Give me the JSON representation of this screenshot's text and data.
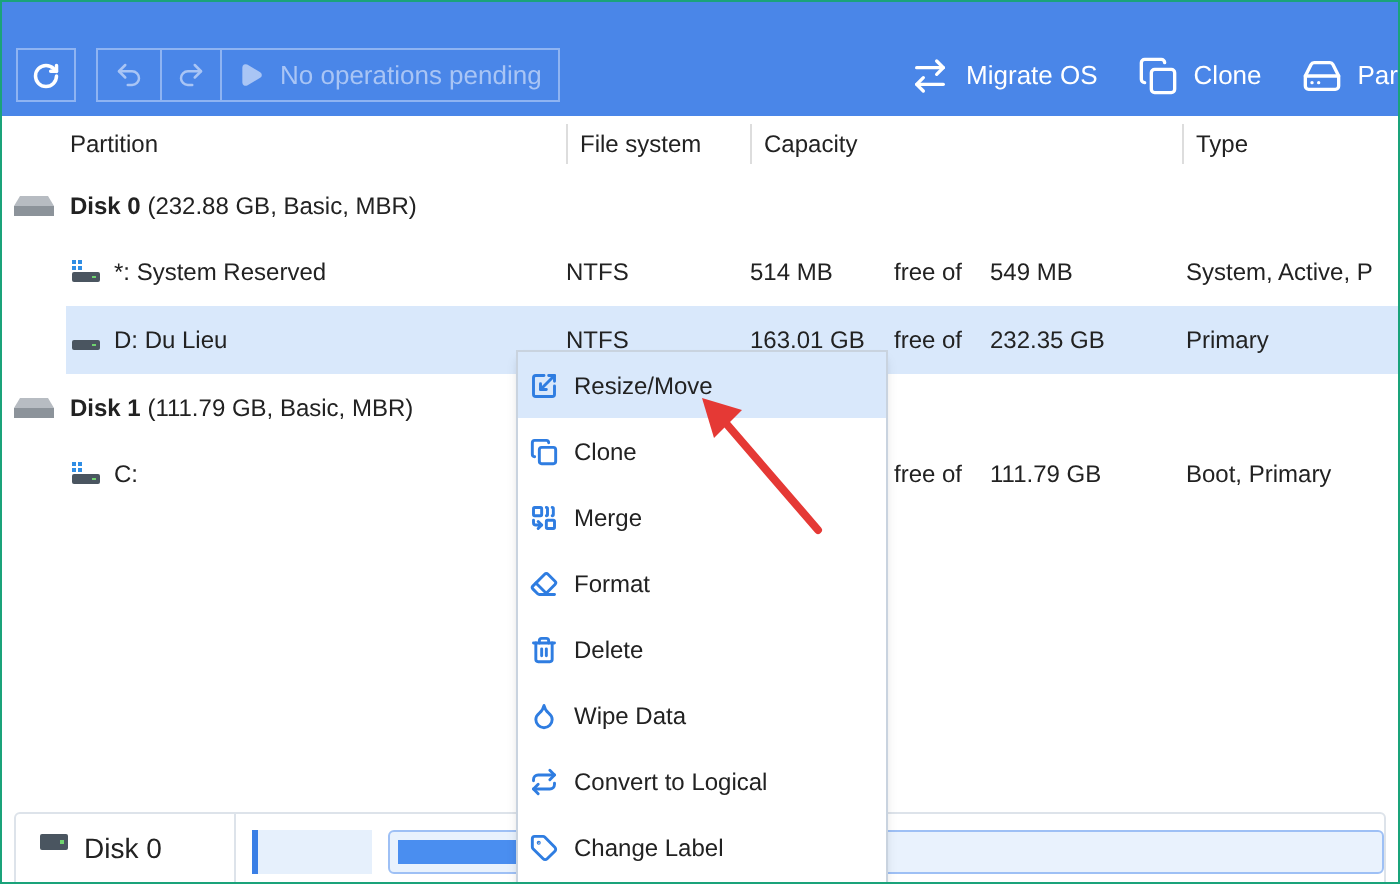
{
  "toolbar": {
    "pending_label": "No operations pending",
    "pending_disabled": true,
    "actions": [
      {
        "kind": "migrate",
        "label": "Migrate OS"
      },
      {
        "kind": "clone",
        "label": "Clone"
      },
      {
        "kind": "partition",
        "label": "Par"
      }
    ]
  },
  "table": {
    "columns": [
      "Partition",
      "File system",
      "Capacity",
      "Type"
    ],
    "rows": [
      {
        "kind": "disk",
        "name": "Disk 0",
        "details": "(232.88 GB, Basic, MBR)"
      },
      {
        "kind": "partition",
        "name": "*: System Reserved",
        "file_system": "NTFS",
        "used": "514 MB",
        "free_of": "free of",
        "total": "549 MB",
        "type": "System, Active, P",
        "selected": false
      },
      {
        "kind": "partition",
        "name": "D: Du Lieu",
        "file_system": "NTFS",
        "used": "163.01 GB",
        "free_of": "free of",
        "total": "232.35 GB",
        "type": "Primary",
        "selected": true
      },
      {
        "kind": "disk",
        "name": "Disk 1",
        "details": "(111.79 GB, Basic, MBR)"
      },
      {
        "kind": "partition",
        "name": "C:",
        "free_of": "free of",
        "total": "111.79 GB",
        "type": "Boot, Primary",
        "selected": false
      }
    ]
  },
  "context_menu": [
    {
      "kind": "resize",
      "label": "Resize/Move",
      "selected": true
    },
    {
      "kind": "clone",
      "label": "Clone",
      "selected": false
    },
    {
      "kind": "merge",
      "label": "Merge",
      "selected": false
    },
    {
      "kind": "format",
      "label": "Format",
      "selected": false
    },
    {
      "kind": "delete",
      "label": "Delete",
      "selected": false
    },
    {
      "kind": "wipe",
      "label": "Wipe Data",
      "selected": false
    },
    {
      "kind": "convert",
      "label": "Convert to Logical",
      "selected": false
    },
    {
      "kind": "label",
      "label": "Change Label",
      "selected": false
    }
  ],
  "disk_map": {
    "name": "Disk 0"
  }
}
